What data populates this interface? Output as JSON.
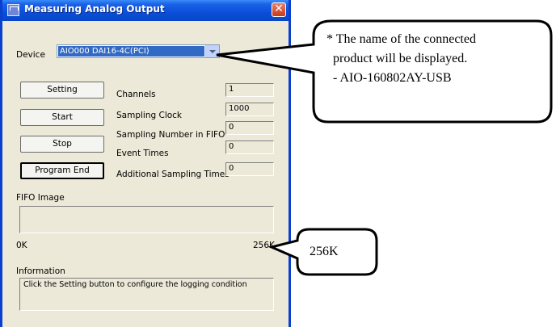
{
  "window": {
    "title": "Measuring Analog Output",
    "close_glyph": "✕"
  },
  "device": {
    "label": "Device",
    "value": "AIO000 DAI16-4C(PCI)"
  },
  "buttons": {
    "setting": "Setting",
    "start": "Start",
    "stop": "Stop",
    "program_end": "Program End"
  },
  "fields": [
    {
      "label": "Channels",
      "value": "1"
    },
    {
      "label": "Sampling Clock",
      "value": "1000"
    },
    {
      "label": "Sampling Number in FIFO",
      "value": "0"
    },
    {
      "label": "Event Times",
      "value": "0"
    },
    {
      "label": "Additional Sampling Times",
      "value": "0"
    }
  ],
  "fifo": {
    "label": "FIFO Image",
    "min_label": "0K",
    "max_label": "256K",
    "fill_fraction": 0
  },
  "information": {
    "label": "Information",
    "text": "Click the Setting button to configure the logging condition"
  },
  "callouts": {
    "device_note": {
      "line1": "* The name of the connected",
      "line2": "product will be displayed.",
      "line3": "- AIO-160802AY-USB"
    },
    "fifo_note": "256K"
  },
  "colors": {
    "titlebar": "#0a4fd8",
    "window_bg": "#ece9d8",
    "selection": "#316ac5",
    "close": "#c8381a"
  }
}
